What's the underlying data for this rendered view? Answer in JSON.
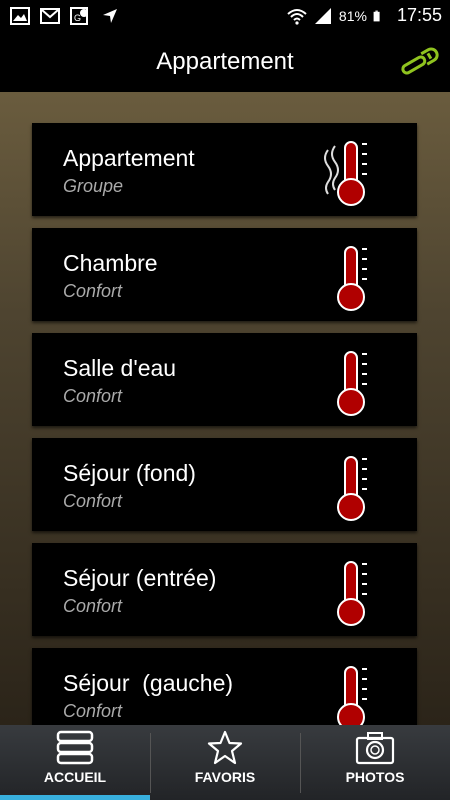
{
  "status_bar": {
    "left_icons": [
      "image-icon",
      "gmail-icon",
      "maps-icon",
      "navigation-icon"
    ],
    "right_icons": [
      "wifi-icon",
      "signal-icon",
      "battery-icon"
    ],
    "battery": "81%",
    "time": "17:55"
  },
  "header": {
    "title": "Appartement",
    "settings_icon": "wrench-icon"
  },
  "rooms": [
    {
      "name": "Appartement",
      "mode": "Groupe",
      "icon": "thermometer-heat-icon"
    },
    {
      "name": "Chambre",
      "mode": "Confort",
      "icon": "thermometer-icon"
    },
    {
      "name": "Salle d'eau",
      "mode": "Confort",
      "icon": "thermometer-icon"
    },
    {
      "name": "Séjour (fond)",
      "mode": "Confort",
      "icon": "thermometer-icon"
    },
    {
      "name": "Séjour (entrée)",
      "mode": "Confort",
      "icon": "thermometer-icon"
    },
    {
      "name": "Séjour  (gauche)",
      "mode": "Confort",
      "icon": "thermometer-icon"
    }
  ],
  "tabs": [
    {
      "label": "ACCUEIL",
      "icon": "stack-icon",
      "active": true
    },
    {
      "label": "FAVORIS",
      "icon": "star-icon",
      "active": false
    },
    {
      "label": "PHOTOS",
      "icon": "camera-icon",
      "active": false
    }
  ],
  "colors": {
    "thermometer_fill": "#b00000",
    "wrench": "#8fc31f",
    "active_tab": "#38b0de"
  }
}
